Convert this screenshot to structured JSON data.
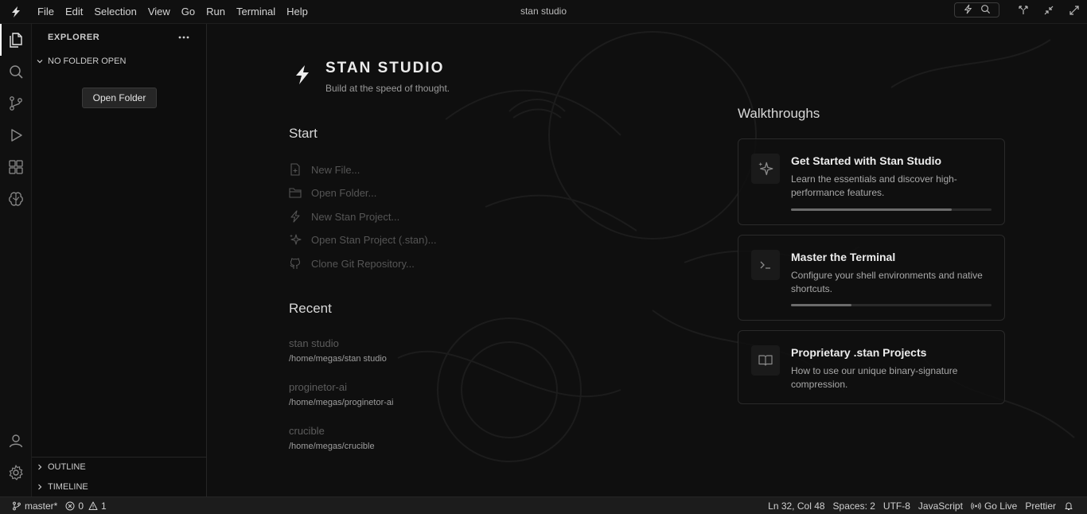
{
  "titlebar": {
    "menu": [
      "File",
      "Edit",
      "Selection",
      "View",
      "Go",
      "Run",
      "Terminal",
      "Help"
    ],
    "window_title": "stan studio"
  },
  "activity": [
    "files-icon",
    "search-icon",
    "source-control-icon",
    "run-debug-icon",
    "extensions-icon",
    "ai-brain-icon",
    "account-icon",
    "settings-gear-icon"
  ],
  "sidebar": {
    "title": "EXPLORER",
    "no_folder": "NO FOLDER OPEN",
    "open_folder": "Open Folder",
    "outline": "OUTLINE",
    "timeline": "TIMELINE"
  },
  "welcome": {
    "brand_name": "STAN STUDIO",
    "brand_tagline": "Build at the speed of thought.",
    "start_heading": "Start",
    "start_items": [
      {
        "label": "New File...",
        "icon": "new-file-icon"
      },
      {
        "label": "Open Folder...",
        "icon": "folder-icon"
      },
      {
        "label": "New Stan Project...",
        "icon": "bolt-icon"
      },
      {
        "label": "Open Stan Project (.stan)...",
        "icon": "sparkles-icon"
      },
      {
        "label": "Clone Git Repository...",
        "icon": "github-icon"
      }
    ],
    "recent_heading": "Recent",
    "recent": [
      {
        "name": "stan studio",
        "path": "/home/megas/stan studio"
      },
      {
        "name": "proginetor-ai",
        "path": "/home/megas/proginetor-ai"
      },
      {
        "name": "crucible",
        "path": "/home/megas/crucible"
      }
    ],
    "walkthroughs_heading": "Walkthroughs",
    "walkthroughs": [
      {
        "title": "Get Started with Stan Studio",
        "desc": "Learn the essentials and discover high-performance features.",
        "icon": "sparkles-icon",
        "progress": 0.8
      },
      {
        "title": "Master the Terminal",
        "desc": "Configure your shell environments and native shortcuts.",
        "icon": "terminal-icon",
        "progress": 0.3
      },
      {
        "title": "Proprietary .stan Projects",
        "desc": "How to use our unique binary-signature compression.",
        "icon": "book-icon"
      }
    ]
  },
  "statusbar": {
    "branch": "master*",
    "errors": "0",
    "warnings": "1",
    "position": "Ln 32, Col 48",
    "spaces": "Spaces: 2",
    "encoding": "UTF-8",
    "language": "JavaScript",
    "golive": "Go Live",
    "formatter": "Prettier"
  }
}
